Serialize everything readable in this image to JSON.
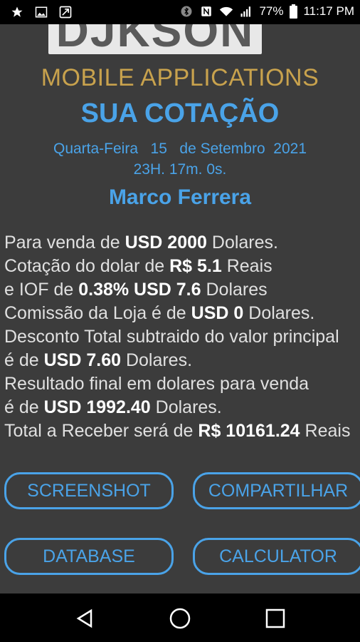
{
  "status_bar": {
    "battery_percent": "77%",
    "time": "11:17 PM",
    "icons_left": [
      "star-icon",
      "image-icon",
      "call-forward-icon"
    ],
    "icons_right": [
      "bluetooth-icon",
      "nfc-icon",
      "wifi-icon",
      "signal-icon",
      "battery-icon"
    ]
  },
  "app": {
    "logo_text": "DJKSON",
    "subtitle": "MOBILE APPLICATIONS",
    "title": "SUA COTAÇÃO",
    "date": "Quarta-Feira   15   de Setembro  2021",
    "time": "23H. 17m. 0s.",
    "name": "Marco Ferrera",
    "lines": [
      {
        "pre": "Para venda de ",
        "bold": "USD 2000",
        "post": " Dolares."
      },
      {
        "pre": "Cotação do dolar de ",
        "bold": "R$ 5.1",
        "post": " Reais"
      },
      {
        "pre": "e IOF de ",
        "bold": "0.38% USD 7.6",
        "post": " Dolares"
      },
      {
        "pre": "Comissão da Loja é de ",
        "bold": "USD 0",
        "post": " Dolares."
      },
      {
        "pre": "Desconto Total subtraido do valor principal",
        "bold": "",
        "post": ""
      },
      {
        "pre": "é de ",
        "bold": "USD 7.60",
        "post": " Dolares."
      },
      {
        "pre": "Resultado final em dolares para venda",
        "bold": "",
        "post": ""
      },
      {
        "pre": "é de ",
        "bold": "USD 1992.40",
        "post": " Dolares."
      },
      {
        "pre": "Total a Receber será de ",
        "bold": "R$ 10161.24",
        "post": " Reais"
      }
    ],
    "buttons": {
      "screenshot": "SCREENSHOT",
      "share": "COMPARTILHAR",
      "database": "DATABASE",
      "calculator": "CALCULATOR"
    }
  },
  "colors": {
    "accent": "#4aa3e8",
    "gold": "#c8a24d",
    "background": "#3c3c3c"
  }
}
